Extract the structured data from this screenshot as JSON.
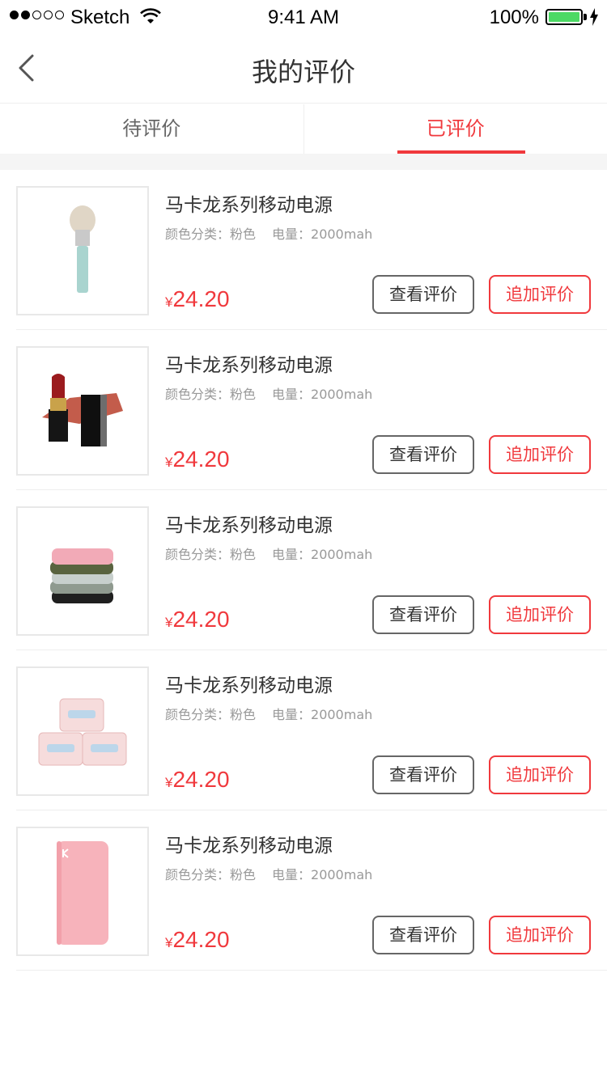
{
  "status_bar": {
    "carrier": "Sketch",
    "time": "9:41 AM",
    "battery": "100%"
  },
  "nav": {
    "title": "我的评价",
    "back_icon": "chevron-left-icon"
  },
  "tabs": [
    {
      "label": "待评价",
      "active": false
    },
    {
      "label": "已评价",
      "active": true
    }
  ],
  "colors": {
    "accent": "#f0393d",
    "battery": "#4cd964"
  },
  "items": [
    {
      "title": "马卡龙系列移动电源",
      "spec_color": "颜色分类：粉色",
      "spec_capacity": "电量：2000mah",
      "currency": "¥",
      "price": "24.20",
      "view_label": "查看评价",
      "add_label": "追加评价",
      "image": "makeup-brush"
    },
    {
      "title": "马卡龙系列移动电源",
      "spec_color": "颜色分类：粉色",
      "spec_capacity": "电量：2000mah",
      "currency": "¥",
      "price": "24.20",
      "view_label": "查看评价",
      "add_label": "追加评价",
      "image": "lipstick"
    },
    {
      "title": "马卡龙系列移动电源",
      "spec_color": "颜色分类：粉色",
      "spec_capacity": "电量：2000mah",
      "currency": "¥",
      "price": "24.20",
      "view_label": "查看评价",
      "add_label": "追加评价",
      "image": "towel-stack"
    },
    {
      "title": "马卡龙系列移动电源",
      "spec_color": "颜色分类：粉色",
      "spec_capacity": "电量：2000mah",
      "currency": "¥",
      "price": "24.20",
      "view_label": "查看评价",
      "add_label": "追加评价",
      "image": "tissue-packs"
    },
    {
      "title": "马卡龙系列移动电源",
      "spec_color": "颜色分类：粉色",
      "spec_capacity": "电量：2000mah",
      "currency": "¥",
      "price": "24.20",
      "view_label": "查看评价",
      "add_label": "追加评价",
      "image": "power-bank"
    }
  ]
}
